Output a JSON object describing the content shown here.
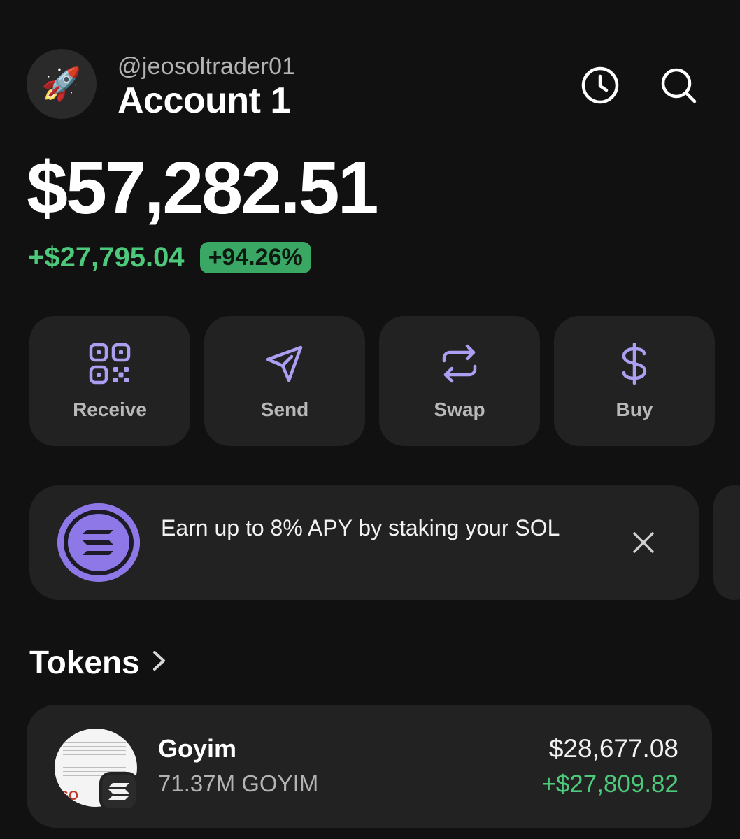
{
  "header": {
    "avatar_emoji": "🚀",
    "handle": "@jeosoltrader01",
    "account_name": "Account 1",
    "icons": [
      "history-icon",
      "search-icon"
    ]
  },
  "balance": {
    "total": "$57,282.51",
    "change_usd": "+$27,795.04",
    "change_pct": "+94.26%"
  },
  "actions": [
    {
      "label": "Receive",
      "icon": "qr-code-icon"
    },
    {
      "label": "Send",
      "icon": "send-icon"
    },
    {
      "label": "Swap",
      "icon": "swap-icon"
    },
    {
      "label": "Buy",
      "icon": "dollar-icon"
    }
  ],
  "banner": {
    "text": "Earn up to 8% APY by staking your SOL",
    "icon": "solana-icon"
  },
  "tokens": {
    "title": "Tokens",
    "items": [
      {
        "name": "Goyim",
        "amount": "71.37M GOYIM",
        "value": "$28,677.08",
        "change": "+$27,809.82"
      }
    ]
  },
  "colors": {
    "background": "#111111",
    "card": "#222222",
    "accent_purple": "#ab9ff2",
    "positive_green": "#4cc97a",
    "badge_green": "#3aa765"
  }
}
